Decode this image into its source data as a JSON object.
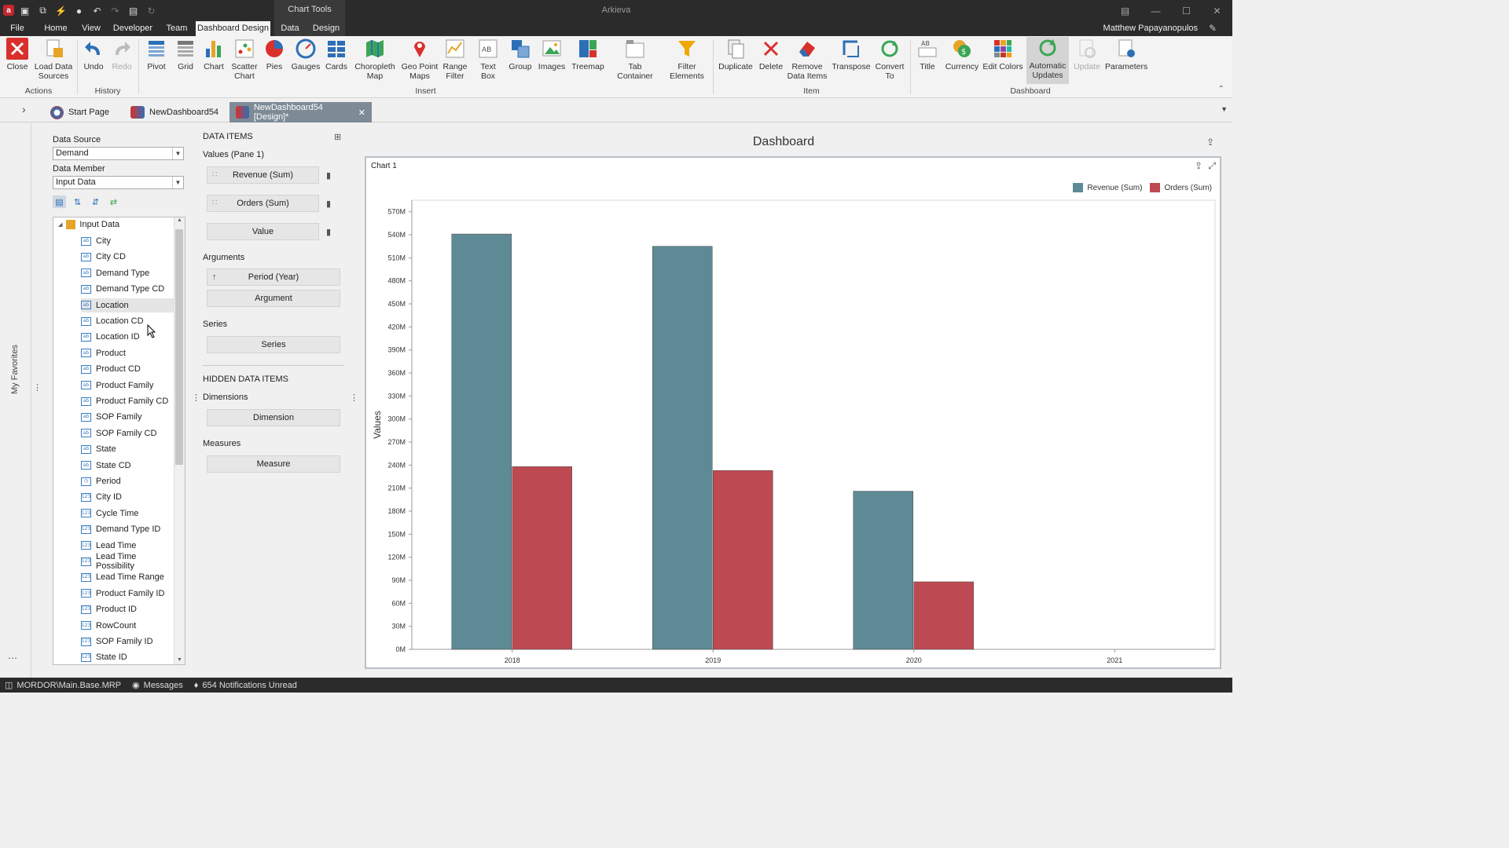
{
  "window": {
    "app_title": "Arkieva",
    "context_header": "Chart Tools",
    "user_name": "Matthew Papayanopulos"
  },
  "ribbon_tabs": [
    {
      "label": "File"
    },
    {
      "label": "Home"
    },
    {
      "label": "View"
    },
    {
      "label": "Developer"
    },
    {
      "label": "Team"
    },
    {
      "label": "Dashboard Design"
    },
    {
      "label": "Data"
    },
    {
      "label": "Design"
    }
  ],
  "ribbon": {
    "close": "Close",
    "load_data_sources": "Load Data Sources",
    "undo": "Undo",
    "redo": "Redo",
    "pivot": "Pivot",
    "grid": "Grid",
    "chart": "Chart",
    "scatter_chart": "Scatter Chart",
    "pies": "Pies",
    "gauges": "Gauges",
    "cards": "Cards",
    "choropleth_map": "Choropleth Map",
    "geo_point_maps": "Geo Point Maps",
    "range_filter": "Range Filter",
    "text_box": "Text Box",
    "group": "Group",
    "images": "Images",
    "treemap": "Treemap",
    "tab_container": "Tab Container",
    "filter_elements": "Filter Elements",
    "duplicate": "Duplicate",
    "delete": "Delete",
    "remove_data_items": "Remove Data Items",
    "transpose": "Transpose",
    "convert_to": "Convert To",
    "title": "Title",
    "currency": "Currency",
    "edit_colors": "Edit Colors",
    "automatic_updates": "Automatic Updates",
    "update": "Update",
    "parameters": "Parameters",
    "groups": {
      "actions": "Actions",
      "history": "History",
      "insert": "Insert",
      "item": "Item",
      "dashboard": "Dashboard"
    }
  },
  "doc_tabs": [
    {
      "label": "Start Page"
    },
    {
      "label": "NewDashboard54"
    },
    {
      "label": "NewDashboard54 [Design]*"
    }
  ],
  "favorites_label": "My Favorites",
  "data_source_panel": {
    "data_source_label": "Data Source",
    "data_source_value": "Demand",
    "data_member_label": "Data Member",
    "data_member_value": "Input Data",
    "tree_root": "Input Data",
    "fields": [
      {
        "label": "City",
        "kind": "text"
      },
      {
        "label": "City CD",
        "kind": "text"
      },
      {
        "label": "Demand Type",
        "kind": "text"
      },
      {
        "label": "Demand Type CD",
        "kind": "text"
      },
      {
        "label": "Location",
        "kind": "text"
      },
      {
        "label": "Location CD",
        "kind": "text"
      },
      {
        "label": "Location ID",
        "kind": "text"
      },
      {
        "label": "Product",
        "kind": "text"
      },
      {
        "label": "Product CD",
        "kind": "text"
      },
      {
        "label": "Product Family",
        "kind": "text"
      },
      {
        "label": "Product Family CD",
        "kind": "text"
      },
      {
        "label": "SOP Family",
        "kind": "text"
      },
      {
        "label": "SOP Family CD",
        "kind": "text"
      },
      {
        "label": "State",
        "kind": "text"
      },
      {
        "label": "State CD",
        "kind": "text"
      },
      {
        "label": "Period",
        "kind": "date"
      },
      {
        "label": "City ID",
        "kind": "number"
      },
      {
        "label": "Cycle Time",
        "kind": "number"
      },
      {
        "label": "Demand Type ID",
        "kind": "number"
      },
      {
        "label": "Lead Time",
        "kind": "number"
      },
      {
        "label": "Lead Time Possibility",
        "kind": "number"
      },
      {
        "label": "Lead Time Range",
        "kind": "number"
      },
      {
        "label": "Product Family ID",
        "kind": "number"
      },
      {
        "label": "Product ID",
        "kind": "number"
      },
      {
        "label": "RowCount",
        "kind": "number"
      },
      {
        "label": "SOP Family ID",
        "kind": "number"
      },
      {
        "label": "State ID",
        "kind": "number"
      }
    ]
  },
  "data_items": {
    "heading": "DATA ITEMS",
    "values_label": "Values (Pane 1)",
    "value_items": [
      "Revenue (Sum)",
      "Orders (Sum)",
      "Value"
    ],
    "arguments_label": "Arguments",
    "argument_items": [
      "Period (Year)",
      "Argument"
    ],
    "series_label": "Series",
    "series_items": [
      "Series"
    ],
    "hidden_heading": "HIDDEN DATA ITEMS",
    "dimensions_label": "Dimensions",
    "dimension_items": [
      "Dimension"
    ],
    "measures_label": "Measures",
    "measure_items": [
      "Measure"
    ]
  },
  "dashboard": {
    "title": "Dashboard",
    "chart_caption": "Chart 1"
  },
  "chart_data": {
    "type": "bar",
    "categories": [
      "2018",
      "2019",
      "2020",
      "2021"
    ],
    "series": [
      {
        "name": "Revenue (Sum)",
        "color": "#5e8a96",
        "values": [
          541,
          525,
          206,
          0
        ]
      },
      {
        "name": "Orders (Sum)",
        "color": "#bd4a52",
        "values": [
          238,
          233,
          88,
          0
        ]
      }
    ],
    "ylabel": "Values",
    "xlabel": "",
    "ylim": [
      0,
      585
    ],
    "y_ticks": [
      "0M",
      "30M",
      "60M",
      "90M",
      "120M",
      "150M",
      "180M",
      "210M",
      "240M",
      "270M",
      "300M",
      "330M",
      "360M",
      "390M",
      "420M",
      "450M",
      "480M",
      "510M",
      "540M",
      "570M"
    ],
    "unit_note": "values in millions",
    "legend_position": "top-right",
    "grid": false
  },
  "status_bar": {
    "path": "MORDOR\\Main.Base.MRP",
    "messages": "Messages",
    "notifications": "654 Notifications Unread"
  }
}
